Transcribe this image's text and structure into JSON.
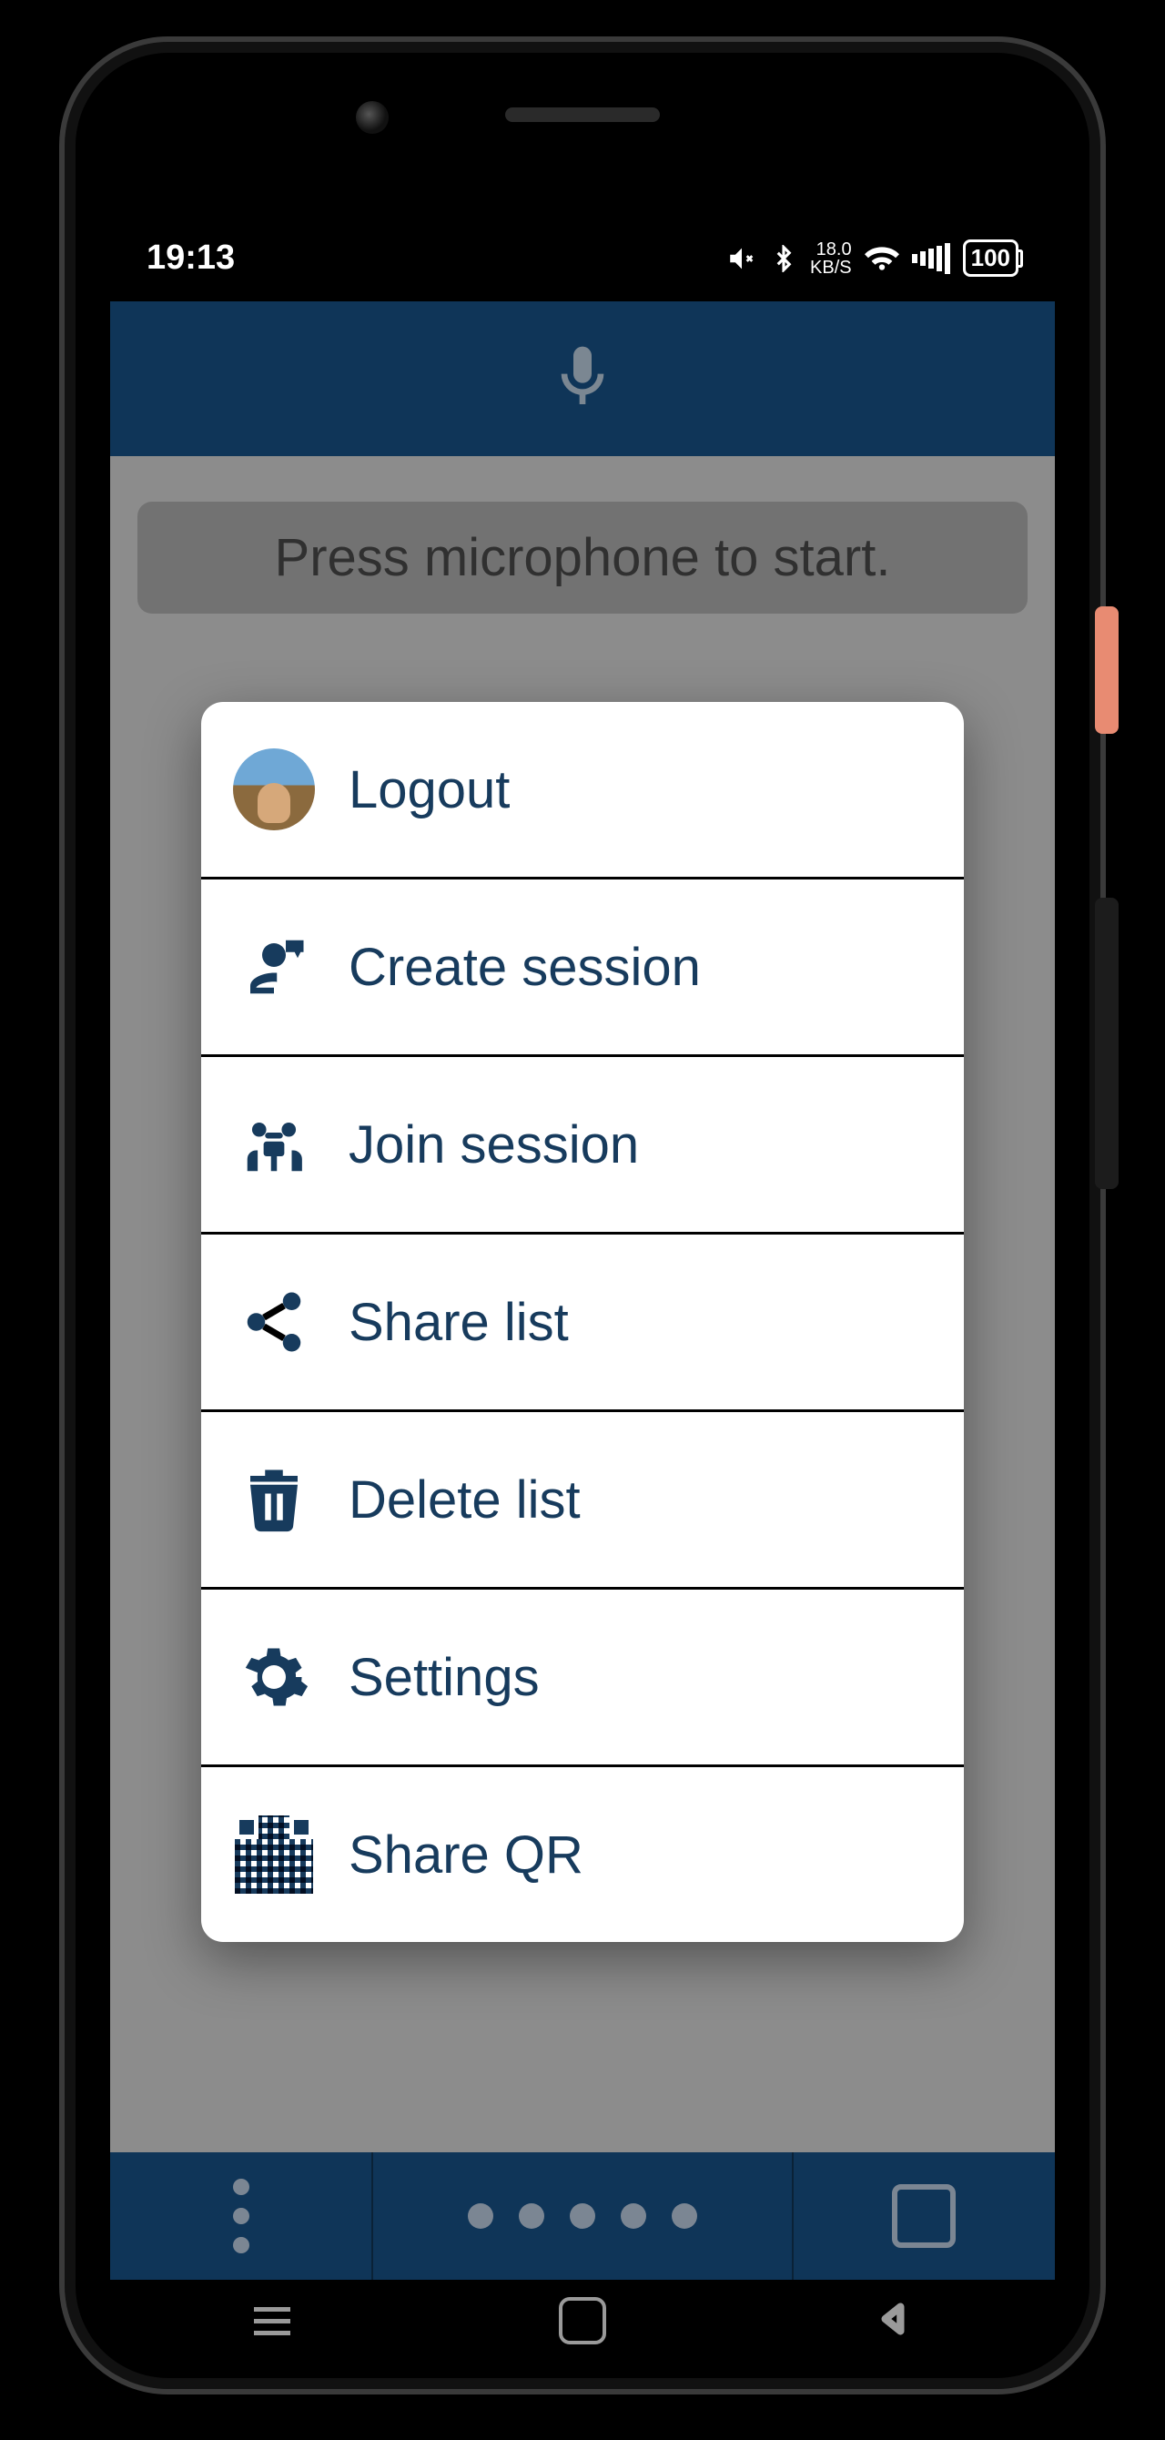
{
  "statusbar": {
    "time": "19:13",
    "net_speed": "18.0",
    "net_unit": "KB/S",
    "battery": "100"
  },
  "app": {
    "hint": "Press microphone to start."
  },
  "menu": {
    "items": [
      {
        "label": "Logout",
        "icon": "avatar"
      },
      {
        "label": "Create session",
        "icon": "create-session"
      },
      {
        "label": "Join session",
        "icon": "join-session"
      },
      {
        "label": "Share list",
        "icon": "share"
      },
      {
        "label": "Delete list",
        "icon": "trash"
      },
      {
        "label": "Settings",
        "icon": "gear"
      },
      {
        "label": "Share QR",
        "icon": "qr"
      }
    ]
  }
}
